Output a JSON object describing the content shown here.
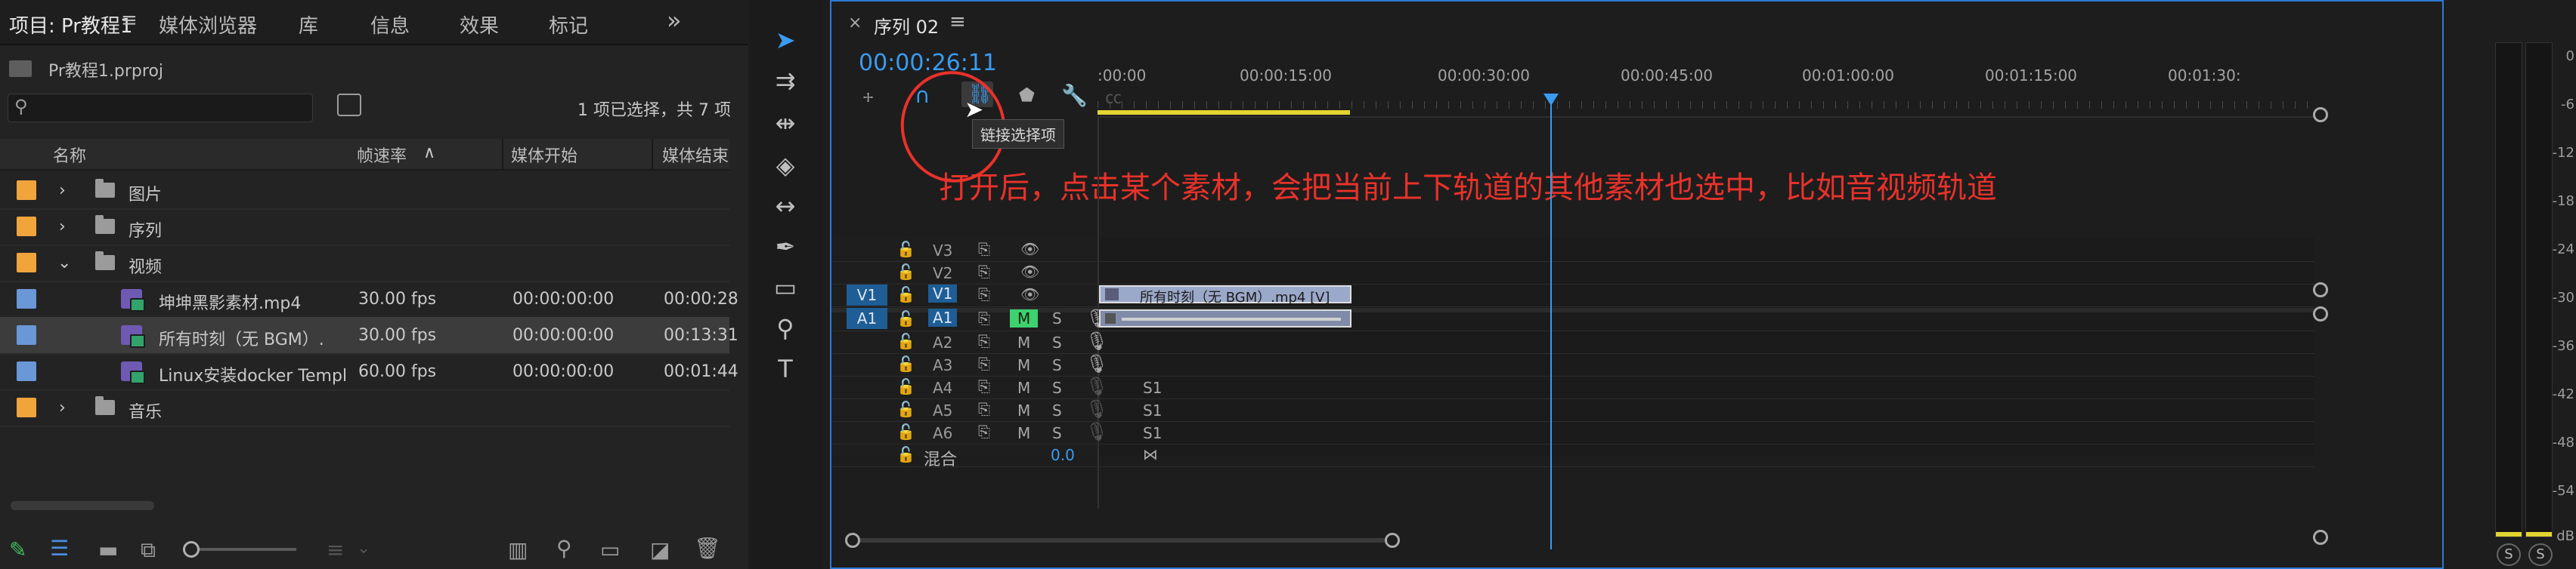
{
  "project_panel": {
    "tabs": [
      "项目: Pr教程1",
      "媒体浏览器",
      "库",
      "信息",
      "效果",
      "标记"
    ],
    "overflow": "»",
    "project_file": "Pr教程1.prproj",
    "selection_status": "1 项已选择，共 7 项",
    "search_value": "",
    "columns": [
      "名称",
      "帧速率",
      "媒体开始",
      "媒体结束"
    ],
    "rows": [
      {
        "name": "图片",
        "type": "folder",
        "fps": "",
        "start": "",
        "end": "",
        "chip": "#f0a43c"
      },
      {
        "name": "序列",
        "type": "folder",
        "fps": "",
        "start": "",
        "end": "",
        "chip": "#f0a43c"
      },
      {
        "name": "视频",
        "type": "folder",
        "fps": "",
        "start": "",
        "end": "",
        "chip": "#f0a43c"
      },
      {
        "name": "坤坤黑影素材.mp4",
        "type": "video",
        "fps": "30.00 fps",
        "start": "00:00:00:00",
        "end": "00:00:28",
        "chip": "#6a97d6"
      },
      {
        "name": "所有时刻（无 BGM）.",
        "type": "video",
        "fps": "30.00 fps",
        "start": "00:00:00:00",
        "end": "00:13:31",
        "chip": "#6a97d6"
      },
      {
        "name": "Linux安装docker Templ",
        "type": "video",
        "fps": "60.00 fps",
        "start": "00:00:00:00",
        "end": "00:01:44",
        "chip": "#6a97d6"
      },
      {
        "name": "音乐",
        "type": "folder",
        "fps": "",
        "start": "",
        "end": "",
        "chip": "#f0a43c"
      }
    ]
  },
  "timeline": {
    "tab": "序列 02",
    "close": "×",
    "timecode": "00:00:26:11",
    "tooltip": "链接选择项",
    "ruler": [
      ":00:00",
      "00:00:15:00",
      "00:00:30:00",
      "00:00:45:00",
      "00:01:00:00",
      "00:01:15:00",
      "00:01:30:"
    ],
    "annotation": "打开后，点击某个素材，会把当前上下轨道的其他素材也选中，比如音视频轨道",
    "video_tracks": [
      "V3",
      "V2",
      "V1"
    ],
    "audio_tracks": [
      "A1",
      "A2",
      "A3",
      "A4",
      "A5",
      "A6"
    ],
    "src_v": "V1",
    "src_a": "A1",
    "m_label": "M",
    "s_label": "S",
    "s1_label": "S1",
    "mix_label": "混合",
    "mix_value": "0.0",
    "clip_label": "所有时刻（无 BGM）.mp4 [V]",
    "accent": "#2d7ad6",
    "timecode_color": "#3a9bf0",
    "annotation_color": "#e8322a"
  },
  "meter": {
    "ticks": [
      "0",
      "-6",
      "-12",
      "-18",
      "-24",
      "-30",
      "-36",
      "-42",
      "-48",
      "-54",
      "dB"
    ],
    "solo": [
      "S",
      "S"
    ]
  }
}
